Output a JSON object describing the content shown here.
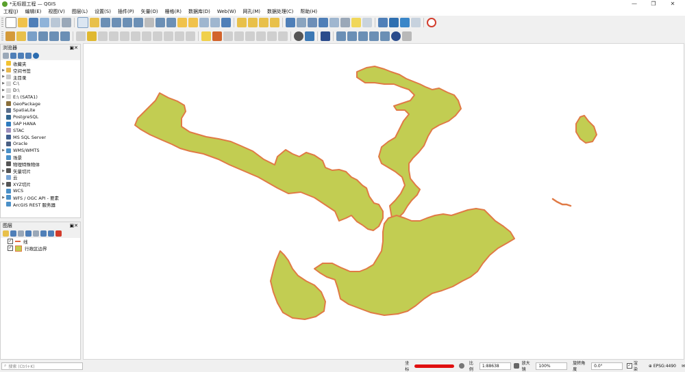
{
  "window": {
    "title": "*无标题工程 — QGIS",
    "minimize": "—",
    "maximize": "❐",
    "close": "✕"
  },
  "menu": [
    "工程(J)",
    "编辑(E)",
    "视图(V)",
    "图层(L)",
    "设置(S)",
    "插件(P)",
    "矢量(O)",
    "栅格(R)",
    "数据库(D)",
    "Web(W)",
    "网孔(M)",
    "数据处理(C)",
    "帮助(H)"
  ],
  "browser": {
    "title": "浏览器",
    "items": [
      {
        "label": "收藏夹",
        "icon": "star-icon",
        "color": "#f2c230",
        "expand": false
      },
      {
        "label": "空间书签",
        "icon": "bookmark-icon",
        "color": "#e7b74e",
        "expand": true
      },
      {
        "label": "主目录",
        "icon": "home-folder-icon",
        "color": "#c9c9c9",
        "expand": true
      },
      {
        "label": "C:\\",
        "icon": "folder-icon",
        "color": "#d8d8d8",
        "expand": true
      },
      {
        "label": "D:\\",
        "icon": "folder-icon",
        "color": "#d8d8d8",
        "expand": true
      },
      {
        "label": "E:\\ (SATA1)",
        "icon": "folder-icon",
        "color": "#d8d8d8",
        "expand": true
      },
      {
        "label": "GeoPackage",
        "icon": "geopackage-icon",
        "color": "#8a6f3a",
        "expand": false
      },
      {
        "label": "SpatiaLite",
        "icon": "spatialite-icon",
        "color": "#5b6f8b",
        "expand": false
      },
      {
        "label": "PostgreSQL",
        "icon": "postgresql-icon",
        "color": "#336791",
        "expand": false
      },
      {
        "label": "SAP HANA",
        "icon": "sap-hana-icon",
        "color": "#2e7bbf",
        "expand": false
      },
      {
        "label": "STAC",
        "icon": "stac-icon",
        "color": "#9b8dbb",
        "expand": false
      },
      {
        "label": "MS SQL Server",
        "icon": "mssql-icon",
        "color": "#3f5f8f",
        "expand": false
      },
      {
        "label": "Oracle",
        "icon": "oracle-icon",
        "color": "#4a5f82",
        "expand": false
      },
      {
        "label": "WMS/WMTS",
        "icon": "wms-icon",
        "color": "#4a90c8",
        "expand": true
      },
      {
        "label": "场景",
        "icon": "scene-icon",
        "color": "#4a90c8",
        "expand": false
      },
      {
        "label": "物理特殊物体",
        "icon": "vector-tile-icon",
        "color": "#555555",
        "expand": false
      },
      {
        "label": "矢量切片",
        "icon": "vector-tiles-icon",
        "color": "#555555",
        "expand": true
      },
      {
        "label": "云",
        "icon": "cloud-icon",
        "color": "#7aa6d6",
        "expand": false
      },
      {
        "label": "XYZ切片",
        "icon": "xyz-tiles-icon",
        "color": "#555555",
        "expand": true
      },
      {
        "label": "WCS",
        "icon": "wcs-icon",
        "color": "#4a90c8",
        "expand": false
      },
      {
        "label": "WFS / OGC API - 要素",
        "icon": "wfs-icon",
        "color": "#4a90c8",
        "expand": true
      },
      {
        "label": "ArcGIS REST 服务器",
        "icon": "arcgis-icon",
        "color": "#4a90c8",
        "expand": false
      }
    ]
  },
  "layers": {
    "title": "图层",
    "items": [
      {
        "name": "线",
        "color": "#e06640",
        "type": "line",
        "checked": "✓"
      },
      {
        "name": "行政区边界",
        "color": "#c3cc4d",
        "type": "polygon",
        "checked": "✓"
      }
    ]
  },
  "map": {
    "polygon_fill": "#c2cd52",
    "outline": "#e07a45"
  },
  "status": {
    "search_placeholder": "搜索 (Ctrl+K)",
    "coordinate_label": "坐标",
    "scale_label": "比例",
    "scale_value": "1:88638",
    "magnifier_label": "放大镜",
    "magnifier_value": "100%",
    "rotation_label": "旋转角度",
    "rotation_value": "0.0°",
    "render_label": "渲染",
    "crs": "EPSG:4490"
  }
}
